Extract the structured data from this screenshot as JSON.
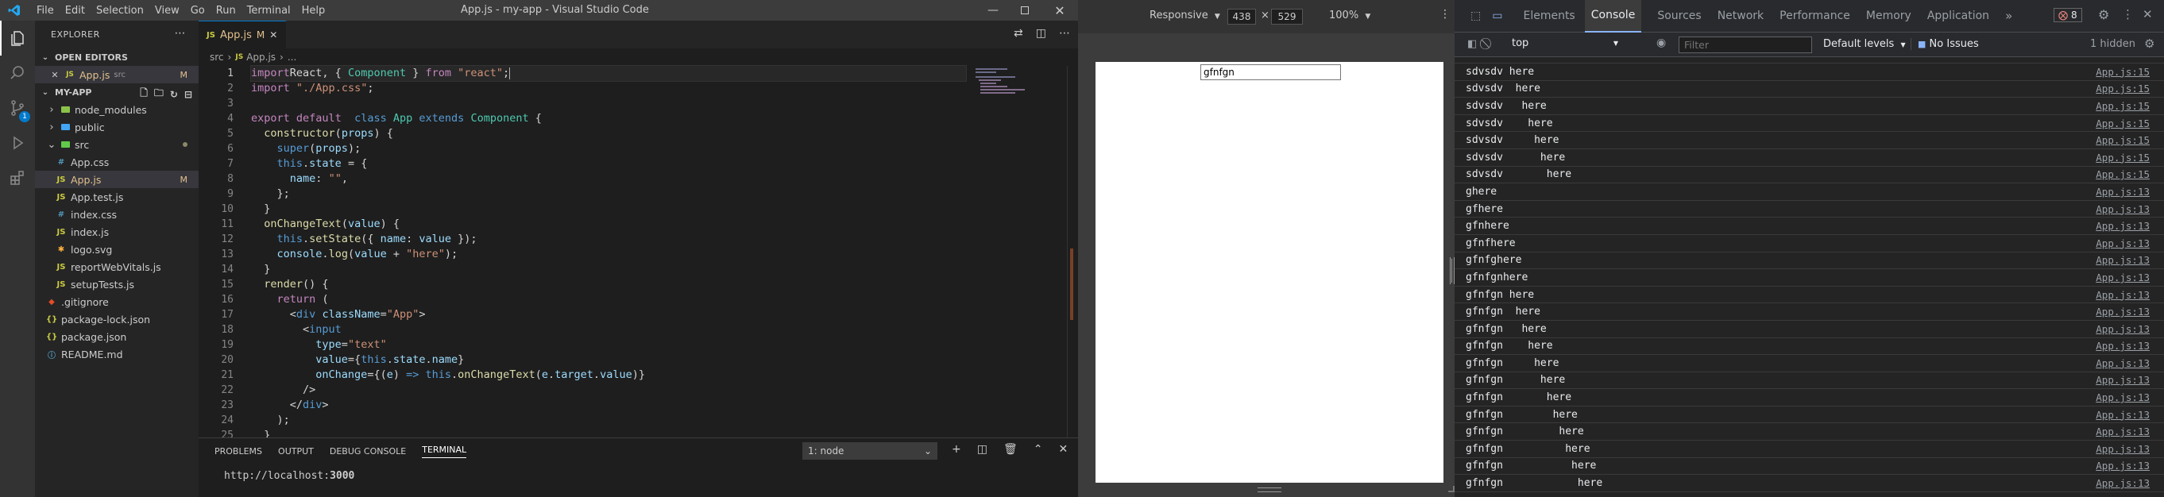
{
  "titlebar": {
    "title": "App.js - my-app - Visual Studio Code",
    "menu": [
      "File",
      "Edit",
      "Selection",
      "View",
      "Go",
      "Run",
      "Terminal",
      "Help"
    ]
  },
  "sidebar": {
    "title": "EXPLORER",
    "open_editors_label": "OPEN EDITORS",
    "open_editor": {
      "name": "App.js",
      "path": "src",
      "badge": "M"
    },
    "project_label": "MY-APP",
    "items": [
      {
        "label": "node_modules",
        "kind": "folder",
        "depth": 1
      },
      {
        "label": "public",
        "kind": "folder",
        "depth": 1
      },
      {
        "label": "src",
        "kind": "folder-open",
        "depth": 1
      },
      {
        "label": "App.css",
        "kind": "css",
        "depth": 2
      },
      {
        "label": "App.js",
        "kind": "js",
        "depth": 2,
        "badge": "M"
      },
      {
        "label": "App.test.js",
        "kind": "js",
        "depth": 2
      },
      {
        "label": "index.css",
        "kind": "css",
        "depth": 2
      },
      {
        "label": "index.js",
        "kind": "js",
        "depth": 2
      },
      {
        "label": "logo.svg",
        "kind": "svg",
        "depth": 2
      },
      {
        "label": "reportWebVitals.js",
        "kind": "js",
        "depth": 2
      },
      {
        "label": "setupTests.js",
        "kind": "js",
        "depth": 2
      },
      {
        "label": ".gitignore",
        "kind": "git",
        "depth": 1
      },
      {
        "label": "package-lock.json",
        "kind": "json",
        "depth": 1
      },
      {
        "label": "package.json",
        "kind": "json",
        "depth": 1
      },
      {
        "label": "README.md",
        "kind": "md",
        "depth": 1
      }
    ]
  },
  "editor": {
    "tab": {
      "label": "App.js",
      "badge": "M"
    },
    "breadcrumb": {
      "folder": "src",
      "file": "App.js",
      "more": "..."
    },
    "lines": [
      [
        [
          "kw",
          "import"
        ],
        [
          "",
          "React, { "
        ],
        [
          "cls",
          "Component"
        ],
        [
          "",
          " } "
        ],
        [
          "kw",
          "from"
        ],
        [
          "",
          " "
        ],
        [
          "str",
          "\"react\""
        ],
        [
          "",
          ";"
        ]
      ],
      [
        [
          "kw",
          "import"
        ],
        [
          "",
          " "
        ],
        [
          "str",
          "\"./App.css\""
        ],
        [
          "",
          ";"
        ]
      ],
      [],
      [
        [
          "kw",
          "export"
        ],
        [
          "",
          " "
        ],
        [
          "kw",
          "default"
        ],
        [
          "",
          "  "
        ],
        [
          "kw2",
          "class"
        ],
        [
          "",
          " "
        ],
        [
          "cls",
          "App"
        ],
        [
          "",
          " "
        ],
        [
          "kw2",
          "extends"
        ],
        [
          "",
          " "
        ],
        [
          "cls",
          "Component"
        ],
        [
          "",
          " {"
        ]
      ],
      [
        [
          "",
          "  "
        ],
        [
          "fn",
          "constructor"
        ],
        [
          "",
          "("
        ],
        [
          "var",
          "props"
        ],
        [
          "",
          ") {"
        ]
      ],
      [
        [
          "",
          "    "
        ],
        [
          "kw2",
          "super"
        ],
        [
          "",
          "("
        ],
        [
          "var",
          "props"
        ],
        [
          "",
          ");"
        ]
      ],
      [
        [
          "",
          "    "
        ],
        [
          "kw2",
          "this"
        ],
        [
          "",
          "."
        ],
        [
          "var",
          "state"
        ],
        [
          "",
          " = {"
        ]
      ],
      [
        [
          "",
          "      "
        ],
        [
          "var",
          "name"
        ],
        [
          "",
          ": "
        ],
        [
          "str",
          "\"\""
        ],
        [
          "",
          ","
        ]
      ],
      [
        [
          "",
          "    };"
        ]
      ],
      [
        [
          "",
          "  }"
        ]
      ],
      [
        [
          "",
          "  "
        ],
        [
          "fn",
          "onChangeText"
        ],
        [
          "",
          "("
        ],
        [
          "var",
          "value"
        ],
        [
          "",
          ") {"
        ]
      ],
      [
        [
          "",
          "    "
        ],
        [
          "kw2",
          "this"
        ],
        [
          "",
          "."
        ],
        [
          "fn",
          "setState"
        ],
        [
          "",
          "({ "
        ],
        [
          "var",
          "name"
        ],
        [
          "",
          ": "
        ],
        [
          "var",
          "value"
        ],
        [
          "",
          " });"
        ]
      ],
      [
        [
          "",
          "    "
        ],
        [
          "var",
          "console"
        ],
        [
          "",
          "."
        ],
        [
          "fn",
          "log"
        ],
        [
          "",
          "("
        ],
        [
          "var",
          "value"
        ],
        [
          "",
          " + "
        ],
        [
          "str",
          "\"here\""
        ],
        [
          "",
          ");"
        ]
      ],
      [
        [
          "",
          "  }"
        ]
      ],
      [
        [
          "",
          "  "
        ],
        [
          "fn",
          "render"
        ],
        [
          "",
          "() {"
        ]
      ],
      [
        [
          "",
          "    "
        ],
        [
          "kw",
          "return"
        ],
        [
          "",
          " ("
        ]
      ],
      [
        [
          "",
          "      <"
        ],
        [
          "tag",
          "div"
        ],
        [
          "",
          " "
        ],
        [
          "var",
          "className"
        ],
        [
          "",
          "="
        ],
        [
          "str",
          "\"App\""
        ],
        [
          "",
          ">"
        ]
      ],
      [
        [
          "",
          "        <"
        ],
        [
          "tag",
          "input"
        ]
      ],
      [
        [
          "",
          "          "
        ],
        [
          "var",
          "type"
        ],
        [
          "",
          "="
        ],
        [
          "str",
          "\"text\""
        ]
      ],
      [
        [
          "",
          "          "
        ],
        [
          "var",
          "value"
        ],
        [
          "",
          "={"
        ],
        [
          "kw2",
          "this"
        ],
        [
          "",
          "."
        ],
        [
          "var",
          "state"
        ],
        [
          "",
          "."
        ],
        [
          "var",
          "name"
        ],
        [
          "",
          "}"
        ]
      ],
      [
        [
          "",
          "          "
        ],
        [
          "var",
          "onChange"
        ],
        [
          "",
          "={("
        ],
        [
          "var",
          "e"
        ],
        [
          "",
          ") "
        ],
        [
          "kw2",
          "=>"
        ],
        [
          "",
          " "
        ],
        [
          "kw2",
          "this"
        ],
        [
          "",
          "."
        ],
        [
          "fn",
          "onChangeText"
        ],
        [
          "",
          "("
        ],
        [
          "var",
          "e"
        ],
        [
          "",
          "."
        ],
        [
          "var",
          "target"
        ],
        [
          "",
          "."
        ],
        [
          "var",
          "value"
        ],
        [
          "",
          ")}"
        ]
      ],
      [
        [
          "",
          "        />"
        ]
      ],
      [
        [
          "",
          "      </"
        ],
        [
          "tag",
          "div"
        ],
        [
          "",
          ">"
        ]
      ],
      [
        [
          "",
          "    );"
        ]
      ],
      [
        [
          "",
          "  }"
        ]
      ]
    ],
    "line_numbers": [
      "1",
      "2",
      "3",
      "4",
      "5",
      "6",
      "7",
      "8",
      "9",
      "10",
      "11",
      "12",
      "13",
      "14",
      "15",
      "16",
      "17",
      "18",
      "19",
      "20",
      "21",
      "22",
      "23",
      "24",
      "25"
    ]
  },
  "panel": {
    "tabs": [
      "PROBLEMS",
      "OUTPUT",
      "DEBUG CONSOLE",
      "TERMINAL"
    ],
    "active_tab": "TERMINAL",
    "terminal_select": "1: node",
    "terminal_text_prefix": "http://localhost:",
    "terminal_text_port": "3000"
  },
  "preview": {
    "device": "Responsive",
    "width": "438",
    "height": "529",
    "zoom": "100%",
    "input_value": "gfnfgn"
  },
  "devtools": {
    "tabs": [
      "Elements",
      "Console",
      "Sources",
      "Network",
      "Performance",
      "Memory",
      "Application"
    ],
    "active_tab": "Console",
    "error_count": "8",
    "context": "top",
    "filter_placeholder": "Filter",
    "levels": "Default levels",
    "issues": "No Issues",
    "hidden": "1 hidden",
    "logs": [
      {
        "text": "sdvsdv here",
        "src": "App.js:15"
      },
      {
        "text": "sdvsdv  here",
        "src": "App.js:15"
      },
      {
        "text": "sdvsdv   here",
        "src": "App.js:15"
      },
      {
        "text": "sdvsdv    here",
        "src": "App.js:15"
      },
      {
        "text": "sdvsdv     here",
        "src": "App.js:15"
      },
      {
        "text": "sdvsdv      here",
        "src": "App.js:15"
      },
      {
        "text": "sdvsdv       here",
        "src": "App.js:15"
      },
      {
        "text": "ghere",
        "src": "App.js:13"
      },
      {
        "text": "gfhere",
        "src": "App.js:13"
      },
      {
        "text": "gfnhere",
        "src": "App.js:13"
      },
      {
        "text": "gfnfhere",
        "src": "App.js:13"
      },
      {
        "text": "gfnfghere",
        "src": "App.js:13"
      },
      {
        "text": "gfnfgnhere",
        "src": "App.js:13"
      },
      {
        "text": "gfnfgn here",
        "src": "App.js:13"
      },
      {
        "text": "gfnfgn  here",
        "src": "App.js:13"
      },
      {
        "text": "gfnfgn   here",
        "src": "App.js:13"
      },
      {
        "text": "gfnfgn    here",
        "src": "App.js:13"
      },
      {
        "text": "gfnfgn     here",
        "src": "App.js:13"
      },
      {
        "text": "gfnfgn      here",
        "src": "App.js:13"
      },
      {
        "text": "gfnfgn       here",
        "src": "App.js:13"
      },
      {
        "text": "gfnfgn        here",
        "src": "App.js:13"
      },
      {
        "text": "gfnfgn         here",
        "src": "App.js:13"
      },
      {
        "text": "gfnfgn          here",
        "src": "App.js:13"
      },
      {
        "text": "gfnfgn           here",
        "src": "App.js:13"
      },
      {
        "text": "gfnfgn            here",
        "src": "App.js:13"
      }
    ]
  },
  "colors": {
    "accent": "#007acc",
    "modified": "#e2c08d",
    "error": "#f28b82"
  }
}
